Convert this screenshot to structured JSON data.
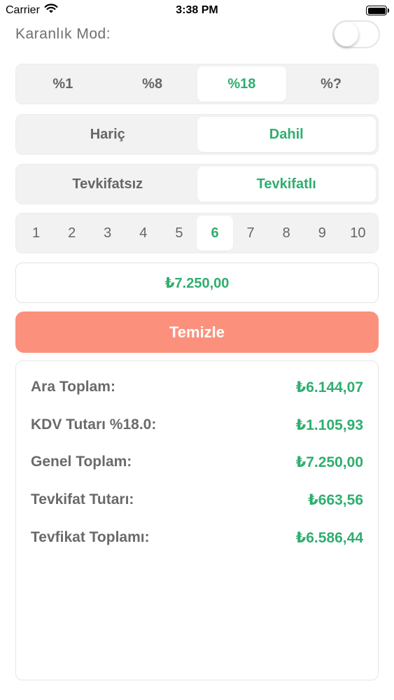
{
  "status_bar": {
    "carrier": "Carrier",
    "time": "3:38 PM",
    "icons": [
      "wifi-icon",
      "battery-icon"
    ]
  },
  "dark_mode": {
    "label": "Karanlık Mod:",
    "enabled": false
  },
  "rate_selector": {
    "options": [
      "%1",
      "%8",
      "%18",
      "%?"
    ],
    "selected_index": 2
  },
  "mode_selector": {
    "options": [
      "Hariç",
      "Dahil"
    ],
    "selected_index": 1
  },
  "withholding_selector": {
    "options": [
      "Tevkifatsız",
      "Tevkifatlı"
    ],
    "selected_index": 1
  },
  "number_selector": {
    "options": [
      "1",
      "2",
      "3",
      "4",
      "5",
      "6",
      "7",
      "8",
      "9",
      "10"
    ],
    "selected_index": 5
  },
  "amount": {
    "value": "₺7.250,00"
  },
  "clear_button": {
    "label": "Temizle"
  },
  "results": {
    "rows": [
      {
        "label": "Ara Toplam:",
        "value": "₺6.144,07"
      },
      {
        "label": "KDV Tutarı %18.0:",
        "value": "₺1.105,93"
      },
      {
        "label": "Genel Toplam:",
        "value": "₺7.250,00"
      },
      {
        "label": "Tevkifat Tutarı:",
        "value": "₺663,56"
      },
      {
        "label": "Tevfikat Toplamı:",
        "value": "₺6.586,44"
      }
    ]
  },
  "colors": {
    "accent_green": "#2fae6f",
    "clear_button": "#fb917c",
    "segment_bg": "#f2f2f3"
  }
}
